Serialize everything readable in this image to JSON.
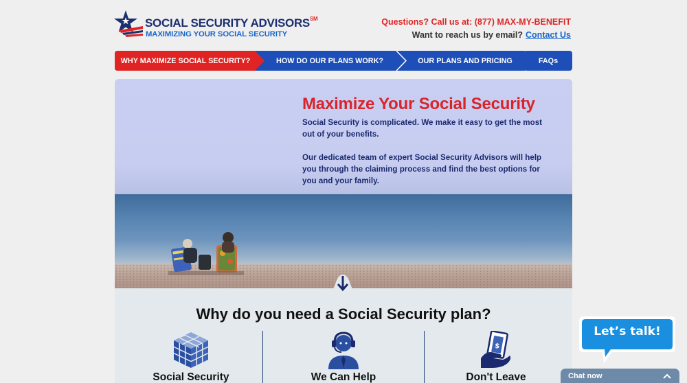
{
  "brand": {
    "name": "SOCIAL SECURITY ADVISORS",
    "mark": "SM",
    "tagline": "MAXIMIZING YOUR SOCIAL SECURITY"
  },
  "contact": {
    "phone_text": "Questions? Call us at: (877) MAX-MY-BENEFIT",
    "email_prompt": "Want to reach us by email?",
    "email_link": "Contact Us"
  },
  "nav": {
    "items": [
      {
        "label": "WHY MAXIMIZE SOCIAL SECURITY?",
        "color": "#e02424"
      },
      {
        "label": "HOW DO OUR PLANS WORK?",
        "color": "#1e4fb9"
      },
      {
        "label": "OUR PLANS AND PRICING",
        "color": "#1e4fb9"
      },
      {
        "label": "FAQs",
        "color": "#1e4fb9"
      }
    ]
  },
  "hero": {
    "title": "Maximize Your Social Security",
    "paragraph1": "Social Security is complicated. We make it easy to get the most out of your benefits.",
    "paragraph2": "Our dedicated team of expert Social Security Advisors will help you through the claiming process and find the best options for you and your family."
  },
  "section": {
    "heading": "Why do you need a Social Security plan?",
    "columns": [
      {
        "label": "Social Security",
        "icon": "cube-icon"
      },
      {
        "label": "We Can Help",
        "icon": "headset-advisor-icon"
      },
      {
        "label": "Don't Leave",
        "icon": "money-hand-icon"
      }
    ]
  },
  "chat": {
    "bubble": "Let’s talk!",
    "bar": "Chat now"
  },
  "colors": {
    "accent_red": "#e02424",
    "accent_blue": "#1e4fb9",
    "navy": "#1b2a6e"
  }
}
